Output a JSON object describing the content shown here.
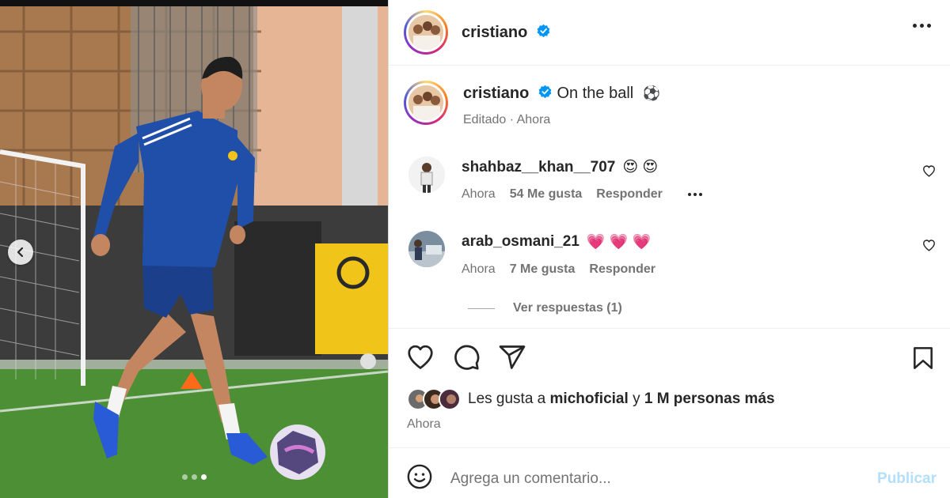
{
  "post": {
    "username": "cristiano",
    "verified": true,
    "caption": "On the ball",
    "caption_emoji": "⚽",
    "caption_meta": "Editado · Ahora",
    "more_icon": "more-horizontal-icon"
  },
  "media": {
    "carousel_count": 3,
    "carousel_active_index": 2,
    "prev_icon": "chevron-left-icon"
  },
  "comments": [
    {
      "username": "shahbaz__khan__707",
      "emoji": "😍 😍",
      "time": "Ahora",
      "likes": "54 Me gusta",
      "reply": "Responder"
    },
    {
      "username": "arab_osmani_21",
      "emoji": "💗 💗 💗",
      "time": "Ahora",
      "likes": "7 Me gusta",
      "reply": "Responder"
    }
  ],
  "view_replies": "Ver respuestas (1)",
  "actions": {
    "like_icon": "heart-icon",
    "comment_icon": "comment-icon",
    "share_icon": "share-icon",
    "save_icon": "bookmark-icon"
  },
  "likes_summary": {
    "prefix": "Les gusta a",
    "user": "michoficial",
    "middle": "y",
    "others": "1 M personas más"
  },
  "post_time": "Ahora",
  "comment_box": {
    "placeholder": "Agrega un comentario...",
    "publish_label": "Publicar",
    "emoji_icon": "smiley-icon"
  },
  "colors": {
    "verified_blue": "#0095f6",
    "publish_disabled": "#b2dffc",
    "text_primary": "#262626",
    "text_secondary": "#737373"
  }
}
